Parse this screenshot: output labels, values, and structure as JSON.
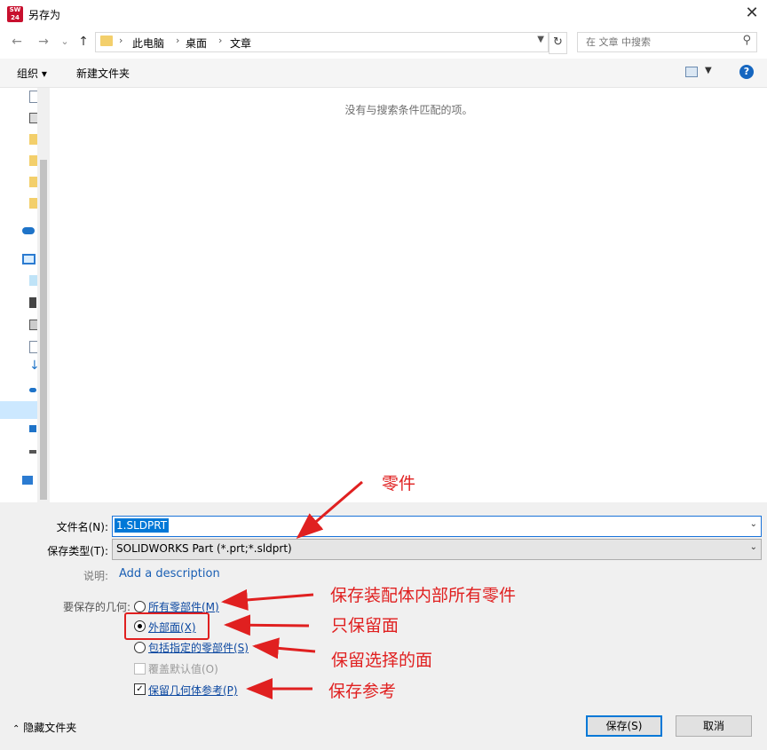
{
  "window": {
    "title": "另存为",
    "close": "✕",
    "app_icon_text": "SW\n2024"
  },
  "nav": {
    "back": "←",
    "forward": "→",
    "recent": "⌄",
    "up": "↑"
  },
  "address": {
    "crumbs": [
      "此电脑",
      "桌面",
      "文章"
    ],
    "separator": "›",
    "refresh": "↻"
  },
  "search": {
    "placeholder": "在 文章 中搜索"
  },
  "toolbar": {
    "organize": "组织 ▾",
    "new_folder": "新建文件夹",
    "help": "?"
  },
  "content": {
    "empty_message": "没有与搜索条件匹配的项。"
  },
  "form": {
    "filename_label": "文件名(N):",
    "filename_value": "1.SLDPRT",
    "filetype_label": "保存类型(T):",
    "filetype_value": "SOLIDWORKS Part (*.prt;*.sldprt)",
    "description_label": "说明:",
    "description_link": "Add a description",
    "geometry_label": "要保存的几何:",
    "options": {
      "all_parts": "所有零部件(M)",
      "exterior_faces": "外部面(X)",
      "specified_parts": "包括指定的零部件(S)",
      "override_defaults": "覆盖默认值(O)",
      "keep_geometry_refs": "保留几何体参考(P)"
    },
    "selected_option": "exterior_faces",
    "keep_geometry_refs_checked": true,
    "override_defaults_checked": false
  },
  "footer": {
    "hide_folders": "隐藏文件夹",
    "save": "保存(S)",
    "cancel": "取消"
  },
  "annotations": {
    "part": "零件",
    "save_all_parts": "保存装配体内部所有零件",
    "only_faces": "只保留面",
    "keep_selected_faces": "保留选择的面",
    "save_reference": "保存参考"
  },
  "colors": {
    "annotation_red": "#e02020",
    "link_blue": "#1a5fb4",
    "selection_blue": "#0078d7"
  }
}
